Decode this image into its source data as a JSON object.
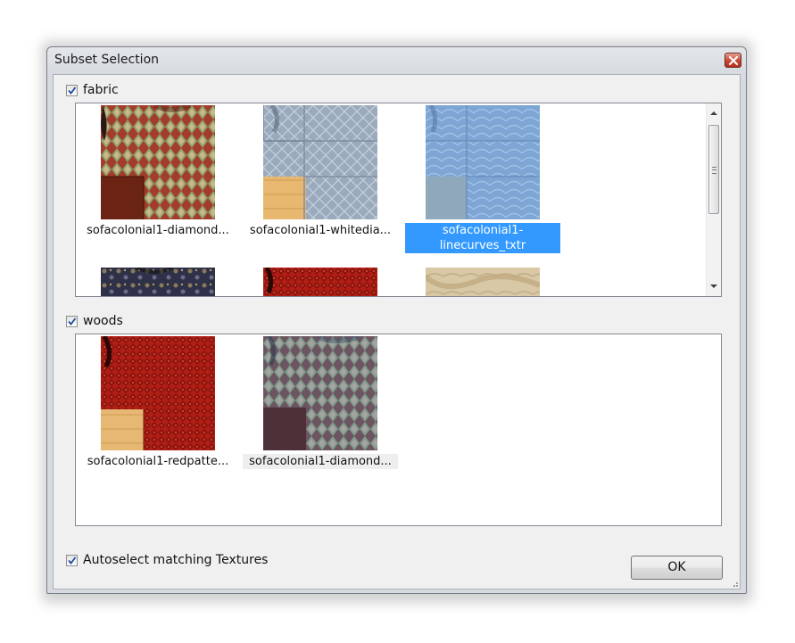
{
  "window": {
    "title": "Subset Selection",
    "close_icon": "close-icon"
  },
  "groups": [
    {
      "label": "fabric",
      "checked": true,
      "items": [
        {
          "caption": "sofacolonial1-diamond...",
          "texture": "red-green-argyle"
        },
        {
          "caption": "sofacolonial1-whitedia...",
          "texture": "blue-grey-diamond"
        },
        {
          "caption": "sofacolonial1-linecurves_txtr",
          "texture": "light-blue-linecurves",
          "selected": true
        },
        {
          "caption": "",
          "texture": "navy-floral"
        },
        {
          "caption": "",
          "texture": "red-pattern"
        },
        {
          "caption": "",
          "texture": "beige-plain"
        }
      ]
    },
    {
      "label": "woods",
      "checked": true,
      "items": [
        {
          "caption": "sofacolonial1-redpatte...",
          "texture": "red-pattern"
        },
        {
          "caption": "sofacolonial1-diamond...",
          "texture": "purple-green-argyle",
          "focused": true
        }
      ]
    }
  ],
  "footer": {
    "autoselect_label": "Autoselect matching Textures",
    "autoselect_checked": true,
    "ok_label": "OK"
  },
  "colors": {
    "selection": "#3399ff",
    "window_frame": "#d7dbe0",
    "client_bg": "#f0f0f0"
  }
}
